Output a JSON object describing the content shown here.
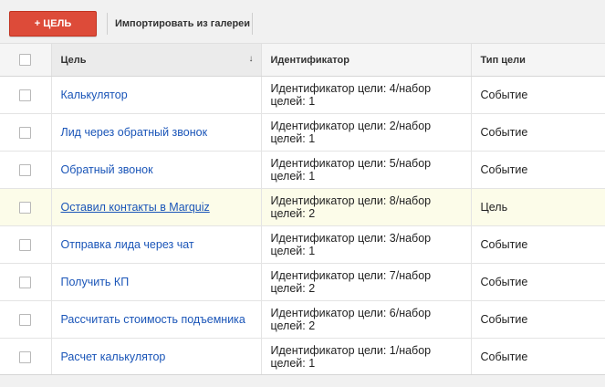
{
  "toolbar": {
    "add_label": "+ ЦЕЛЬ",
    "import_label": "Импортировать из галереи"
  },
  "table": {
    "headers": {
      "goal": "Цель",
      "id": "Идентификатор",
      "type": "Тип цели"
    },
    "sort_indicator": "↓",
    "rows": [
      {
        "name": "Калькулятор",
        "id": "Идентификатор цели: 4/набор целей: 1",
        "type": "Событие"
      },
      {
        "name": "Лид через обратный звонок",
        "id": "Идентификатор цели: 2/набор целей: 1",
        "type": "Событие"
      },
      {
        "name": "Обратный звонок",
        "id": "Идентификатор цели: 5/набор целей: 1",
        "type": "Событие"
      },
      {
        "name": "Оставил контакты в Marquiz",
        "id": "Идентификатор цели: 8/набор целей: 2",
        "type": "Цель"
      },
      {
        "name": "Отправка лида через чат",
        "id": "Идентификатор цели: 3/набор целей: 1",
        "type": "Событие"
      },
      {
        "name": "Получить КП",
        "id": "Идентификатор цели: 7/набор целей: 2",
        "type": "Событие"
      },
      {
        "name": "Рассчитать стоимость подъемника",
        "id": "Идентификатор цели: 6/набор целей: 2",
        "type": "Событие"
      },
      {
        "name": "Расчет калькулятор",
        "id": "Идентификатор цели: 1/набор целей: 1",
        "type": "Событие"
      }
    ]
  },
  "colors": {
    "accent": "#dd4b39",
    "link": "#1a55b8",
    "highlight_row": "#fcfce9"
  }
}
